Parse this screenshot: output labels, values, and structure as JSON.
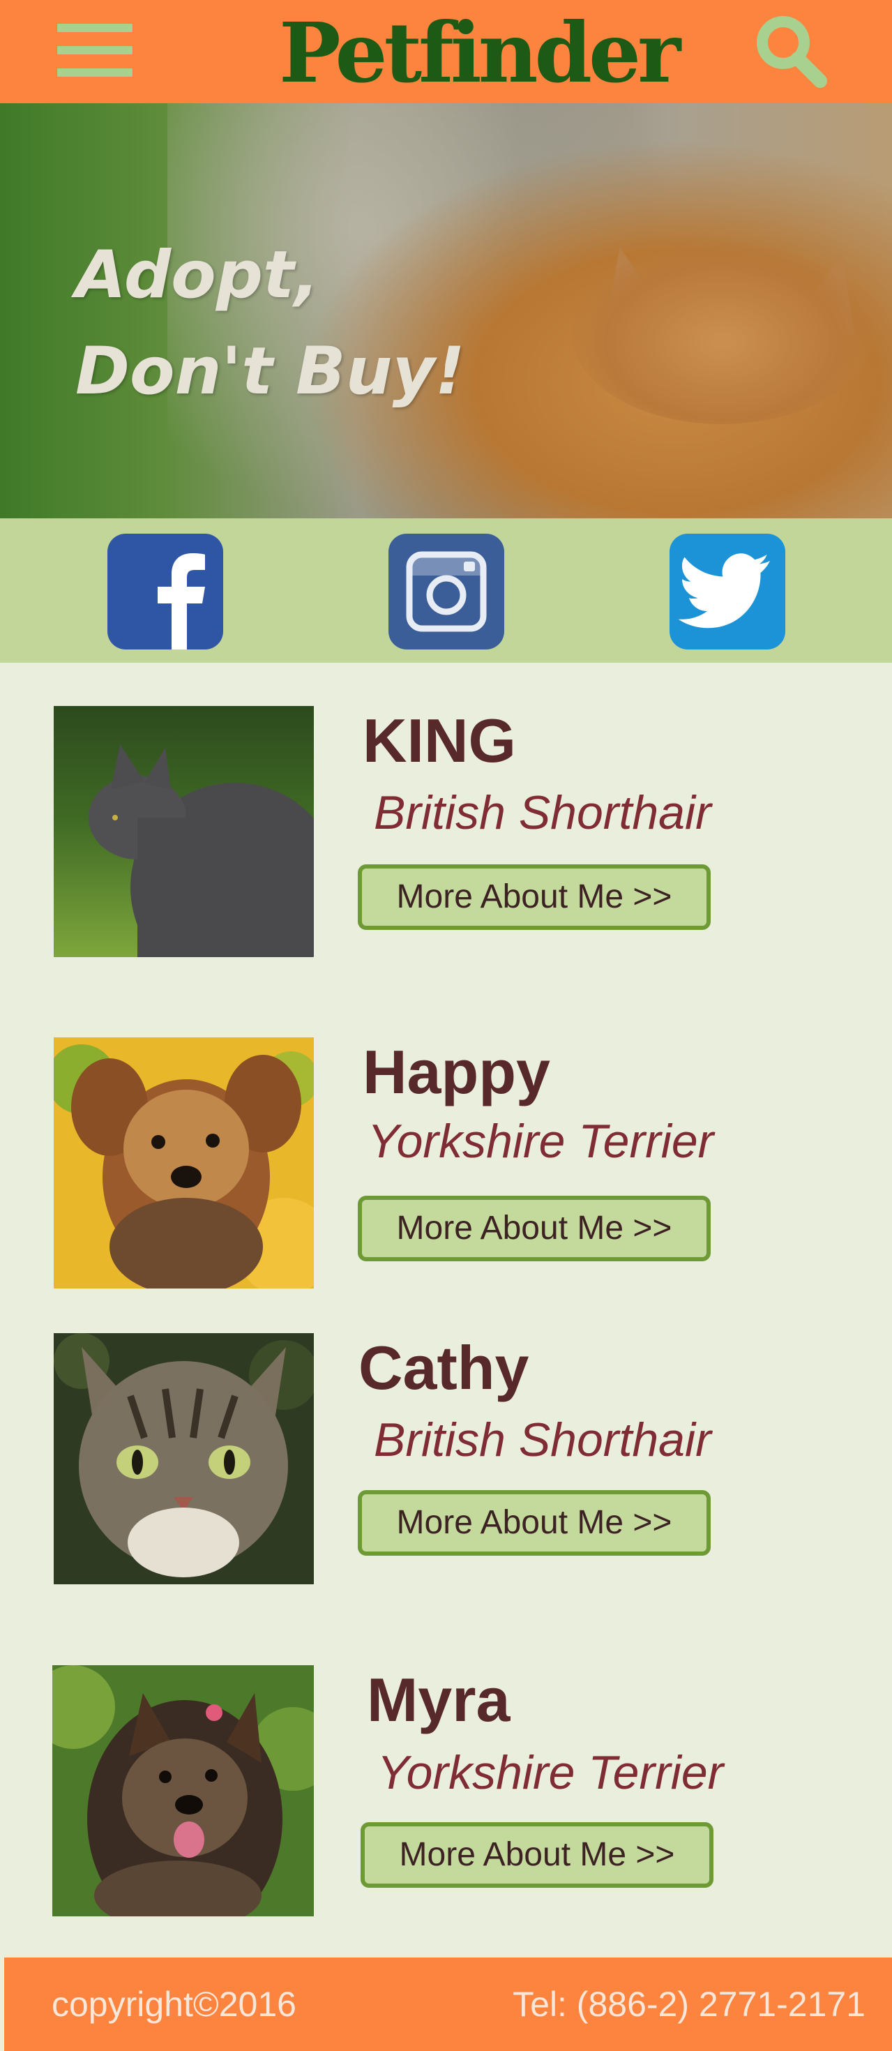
{
  "header": {
    "menu_icon": "hamburger-menu-icon",
    "logo_text": "Petfinder",
    "search_icon": "search-icon",
    "colors": {
      "bar": "#fd843e",
      "logo": "#1d5a15",
      "icons": "#a8d190"
    }
  },
  "hero": {
    "line1": "Adopt,",
    "line2": "Don't Buy!"
  },
  "social": {
    "items": [
      {
        "name": "facebook-icon",
        "color": "#2f56a4"
      },
      {
        "name": "instagram-icon",
        "color": "#3c5e98"
      },
      {
        "name": "twitter-icon",
        "color": "#1b93d6"
      }
    ],
    "background": "#c2d699"
  },
  "pets": [
    {
      "name": "KING",
      "breed": "British Shorthair",
      "button": "More About Me >>"
    },
    {
      "name": "Happy",
      "breed": "Yorkshire Terrier",
      "button": "More About Me >>"
    },
    {
      "name": "Cathy",
      "breed": "British Shorthair",
      "button": "More About Me >>"
    },
    {
      "name": "Myra",
      "breed": "Yorkshire Terrier",
      "button": "More About Me >>"
    }
  ],
  "footer": {
    "copyright": "copyright©2016",
    "tel": "Tel: (886-2) 2771-2171"
  }
}
